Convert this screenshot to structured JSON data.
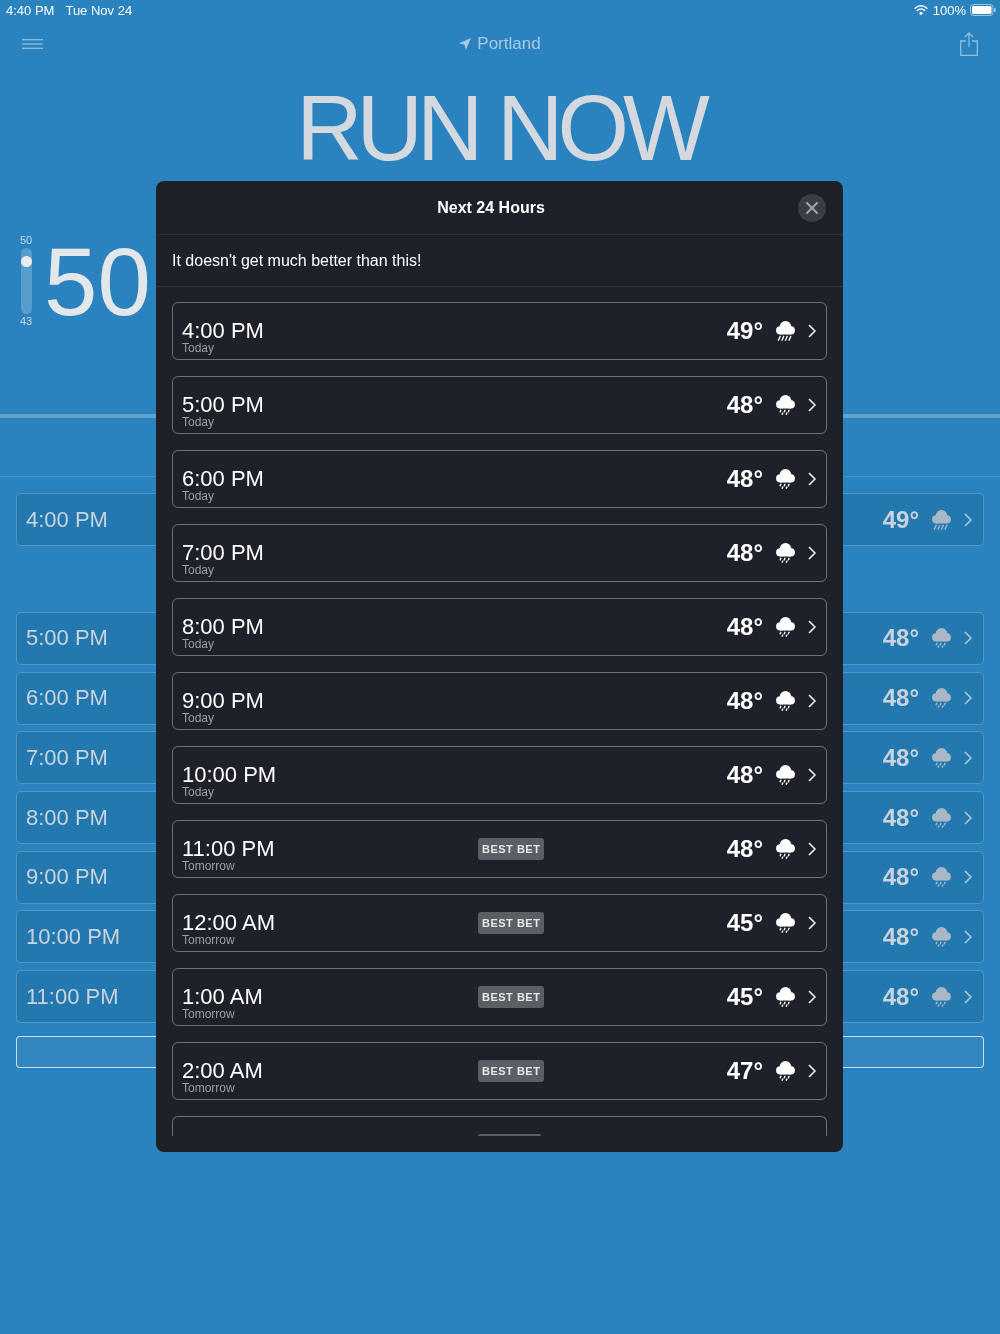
{
  "status_bar": {
    "time": "4:40 PM",
    "date": "Tue Nov 24",
    "battery": "100%"
  },
  "nav": {
    "location": "Portland"
  },
  "headline": "RUN NOW",
  "gauge": {
    "max": "50",
    "min": "43",
    "level": 0.86,
    "value": "50"
  },
  "background_list": {
    "now_row": {
      "time": "4:00 PM",
      "temp": "49°",
      "kind": "rain"
    },
    "rows": [
      {
        "time": "5:00 PM",
        "temp": "48°",
        "kind": "drizzle"
      },
      {
        "time": "6:00 PM",
        "temp": "48°",
        "kind": "drizzle"
      },
      {
        "time": "7:00 PM",
        "temp": "48°",
        "kind": "drizzle"
      },
      {
        "time": "8:00 PM",
        "temp": "48°",
        "kind": "drizzle"
      },
      {
        "time": "9:00 PM",
        "temp": "48°",
        "kind": "drizzle"
      },
      {
        "time": "10:00 PM",
        "temp": "48°",
        "kind": "drizzle"
      },
      {
        "time": "11:00 PM",
        "temp": "48°",
        "kind": "drizzle"
      }
    ]
  },
  "modal": {
    "title": "Next 24 Hours",
    "message": "It doesn't get much better than this!",
    "rows": [
      {
        "time": "4:00 PM",
        "day": "Today",
        "temp": "49°",
        "kind": "rain"
      },
      {
        "time": "5:00 PM",
        "day": "Today",
        "temp": "48°",
        "kind": "drizzle"
      },
      {
        "time": "6:00 PM",
        "day": "Today",
        "temp": "48°",
        "kind": "drizzle"
      },
      {
        "time": "7:00 PM",
        "day": "Today",
        "temp": "48°",
        "kind": "drizzle"
      },
      {
        "time": "8:00 PM",
        "day": "Today",
        "temp": "48°",
        "kind": "drizzle"
      },
      {
        "time": "9:00 PM",
        "day": "Today",
        "temp": "48°",
        "kind": "drizzle"
      },
      {
        "time": "10:00 PM",
        "day": "Today",
        "temp": "48°",
        "kind": "drizzle"
      },
      {
        "time": "11:00 PM",
        "day": "Tomorrow",
        "badge": "BEST BET",
        "temp": "48°",
        "kind": "drizzle"
      },
      {
        "time": "12:00 AM",
        "day": "Tomorrow",
        "badge": "BEST BET",
        "temp": "45°",
        "kind": "drizzle"
      },
      {
        "time": "1:00 AM",
        "day": "Tomorrow",
        "badge": "BEST BET",
        "temp": "45°",
        "kind": "drizzle"
      },
      {
        "time": "2:00 AM",
        "day": "Tomorrow",
        "badge": "BEST BET",
        "temp": "47°",
        "kind": "drizzle"
      }
    ],
    "partial_row": {
      "best_bet": true
    }
  }
}
